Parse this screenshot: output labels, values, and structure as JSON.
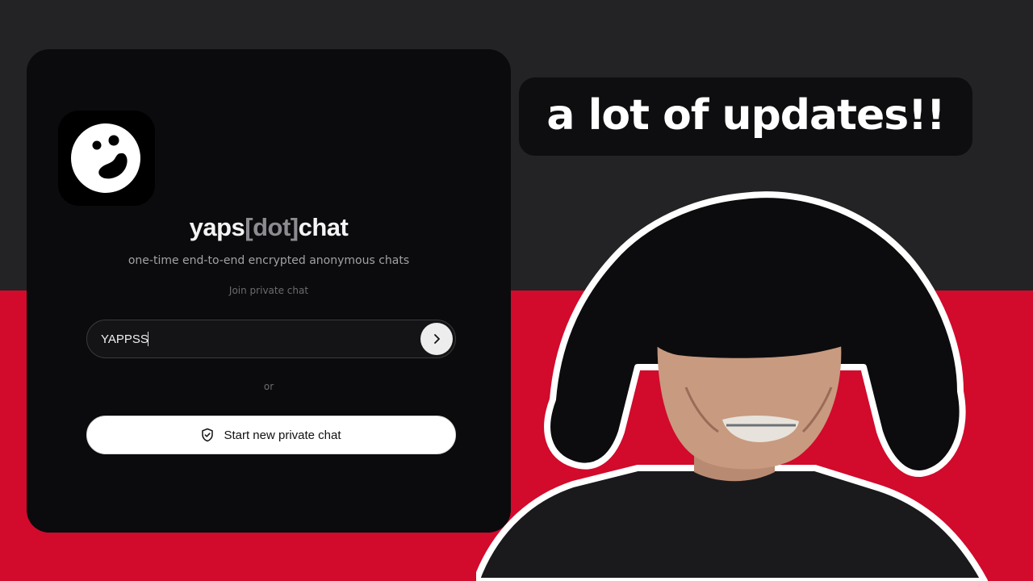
{
  "app": {
    "brand_prefix": "yaps",
    "brand_mid": "[dot]",
    "brand_suffix": "chat",
    "tagline": "one-time end-to-end encrypted anonymous chats",
    "logo_icon": "smiley-blob-logo-icon"
  },
  "join": {
    "label": "Join private chat",
    "input_value": "YAPPSS",
    "submit_icon": "chevron-right-icon"
  },
  "divider": {
    "text": "or"
  },
  "start": {
    "label": "Start new private chat",
    "icon": "shield-check-icon"
  },
  "overlay": {
    "banner_text": "a lot of updates!!"
  },
  "colors": {
    "top_background": "#232325",
    "bottom_background": "#d20a2c",
    "card_background": "#0b0b0d",
    "button_background": "#ffffff"
  }
}
